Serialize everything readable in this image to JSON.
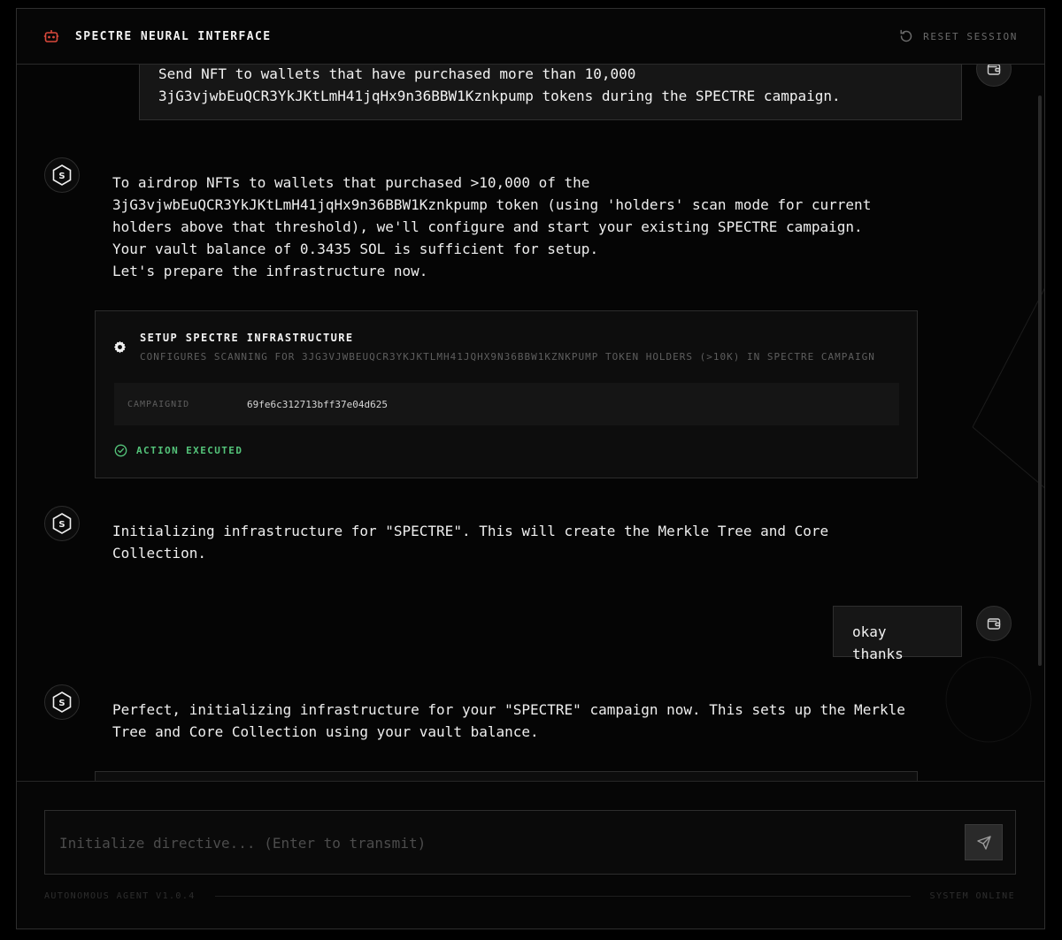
{
  "header": {
    "title": "SPECTRE NEURAL INTERFACE",
    "reset_label": "RESET SESSION",
    "brand_icon": "robot-icon",
    "reset_icon": "rotate-ccw-icon"
  },
  "messages": [
    {
      "role": "user",
      "text": "Send NFT to wallets that have purchased more than 10,000 3jG3vjwbEuQCR3YkJKtLmH41jqHx9n36BBW1Kznkpump tokens during the SPECTRE campaign."
    },
    {
      "role": "agent",
      "avatar_letter": "S",
      "text": "To airdrop NFTs to wallets that purchased >10,000 of the\n3jG3vjwbEuQCR3YkJKtLmH41jqHx9n36BBW1Kznkpump token (using 'holders' scan mode for current\nholders above that threshold), we'll configure and start your existing SPECTRE campaign.\nYour vault balance of 0.3435 SOL is sufficient for setup.\nLet's prepare the infrastructure now.",
      "action": {
        "title": "SETUP SPECTRE INFRASTRUCTURE",
        "description": "CONFIGURES SCANNING FOR 3JG3VJWBEUQCR3YKJKTLMH41JQHX9N36BBW1KZNKPUMP TOKEN HOLDERS (>10K) IN SPECTRE CAMPAIGN",
        "param_key": "CAMPAIGNID",
        "param_value": "69fe6c312713bff37e04d625",
        "status": "ACTION EXECUTED"
      }
    },
    {
      "role": "agent",
      "avatar_letter": "S",
      "text": "Initializing infrastructure for \"SPECTRE\". This will create the Merkle Tree and Core\nCollection."
    },
    {
      "role": "user",
      "text": "okay thanks"
    },
    {
      "role": "agent",
      "avatar_letter": "S",
      "text": "Perfect, initializing infrastructure for your \"SPECTRE\" campaign now. This sets up the Merkle\nTree and Core Collection using your vault balance."
    }
  ],
  "composer": {
    "placeholder": "Initialize directive... (Enter to transmit)",
    "value": "",
    "send_icon": "send-icon"
  },
  "footer": {
    "version": "AUTONOMOUS AGENT V1.0.4",
    "status": "SYSTEM ONLINE"
  },
  "colors": {
    "background": "#050505",
    "accent_red": "#d9483b",
    "success_green": "#54c47a"
  }
}
